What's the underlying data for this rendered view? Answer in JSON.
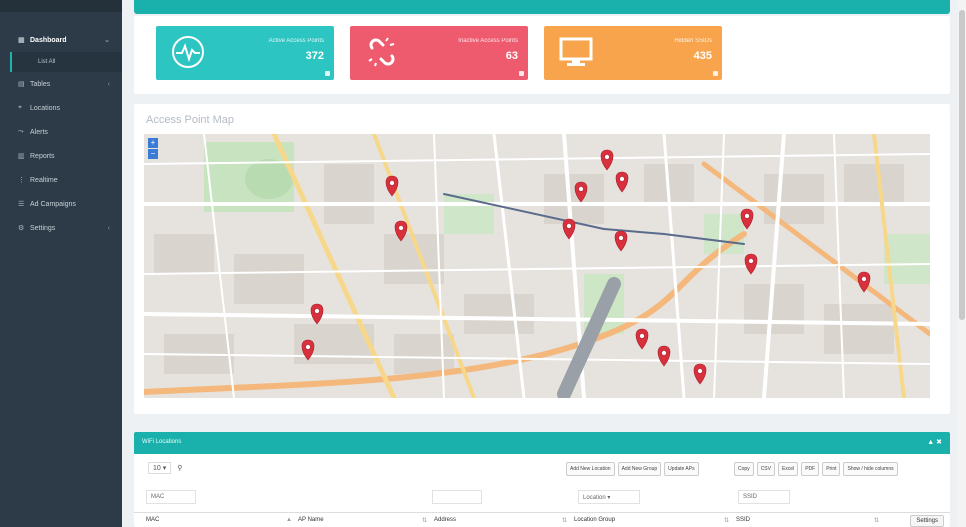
{
  "sidebar": {
    "items": [
      {
        "icon": "grid-icon",
        "glyph": "▦",
        "label": "Dashboard",
        "active": true,
        "submenu": true
      },
      {
        "icon": "table-icon",
        "glyph": "▤",
        "label": "Tables",
        "active": false,
        "submenu": true
      },
      {
        "icon": "location-icon",
        "glyph": "⌖",
        "label": "Locations",
        "active": false,
        "submenu": false
      },
      {
        "icon": "alert-icon",
        "glyph": "⤳",
        "label": "Alerts",
        "active": false,
        "submenu": false
      },
      {
        "icon": "report-icon",
        "glyph": "▥",
        "label": "Reports",
        "active": false,
        "submenu": false
      },
      {
        "icon": "realtime-icon",
        "glyph": "⋮",
        "label": "Realtime",
        "active": false,
        "submenu": false
      },
      {
        "icon": "campaign-icon",
        "glyph": "☰",
        "label": "Ad Campaigns",
        "active": false,
        "submenu": false
      },
      {
        "icon": "settings-icon",
        "glyph": "⚙",
        "label": "Settings",
        "active": false,
        "submenu": true
      }
    ],
    "sub_item": "List All"
  },
  "stats": {
    "active": {
      "label": "Active Access Points",
      "value": "372",
      "color": "#2dc5c1"
    },
    "inactive": {
      "label": "Inactive Access Points",
      "value": "63",
      "color": "#ef5b6e"
    },
    "hidden": {
      "label": "Hidden SSIDs",
      "value": "435",
      "color": "#f7a44d"
    }
  },
  "map": {
    "title": "Access Point Map",
    "zoom_in": "+",
    "zoom_out": "−"
  },
  "table": {
    "title": "WiFi Locations",
    "controls": "▲ ✖",
    "page_size": "10",
    "buttons": [
      "Add New Location",
      "Add New Group",
      "Update APs",
      "Copy",
      "CSV",
      "Excel",
      "PDF",
      "Print",
      "Show / hide columns"
    ],
    "filters": {
      "mac": "MAC",
      "location": "Location",
      "ssid": "SSID"
    },
    "columns": [
      "MAC",
      "AP Name",
      "Address",
      "Location Group",
      "SSID"
    ],
    "settings": "Settings"
  },
  "colors": {
    "accent": "#1ab1ac",
    "sidebar": "#2c3b47",
    "pin": "#d9303e"
  }
}
